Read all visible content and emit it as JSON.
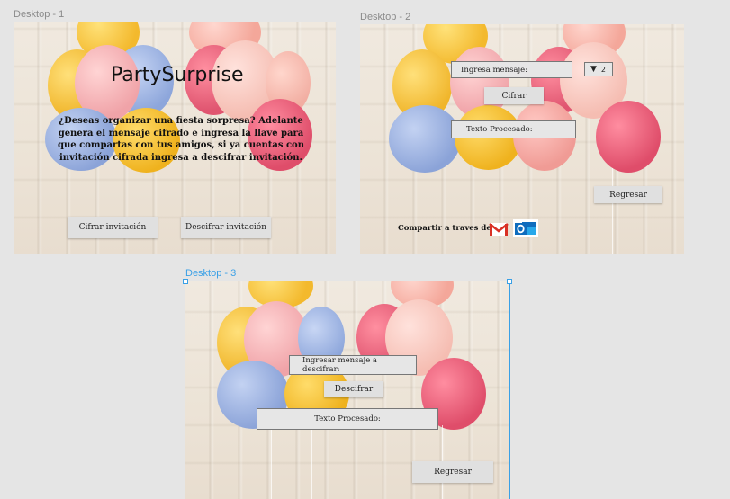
{
  "frames": {
    "desktop1": {
      "label": "Desktop - 1"
    },
    "desktop2": {
      "label": "Desktop - 2"
    },
    "desktop3": {
      "label": "Desktop - 3"
    }
  },
  "screen1": {
    "title": "PartySurprise",
    "description": "¿Deseas organizar una fiesta sorpresa? Adelante genera el mensaje cifrado e ingresa la llave para que compartas con tus amigos, si ya cuentas con invitación cifrada ingresa a descifrar invitación.",
    "encrypt_button": "Cifrar invitación",
    "decrypt_button": "Descifrar invitación"
  },
  "screen2": {
    "message_field": "Ingresa mensaje:",
    "key_select": {
      "arrow": "▼",
      "value": "2"
    },
    "encrypt_button": "Cifrar",
    "processed_field": "Texto Procesado:",
    "back_button": "Regresar",
    "share_label": "Compartir a traves de :",
    "share_icons": [
      "gmail-icon",
      "outlook-icon"
    ]
  },
  "screen3": {
    "message_field": "Ingresar mensaje a descifrar:",
    "decrypt_button": "Descifrar",
    "processed_field": "Texto Procesado:",
    "back_button": "Regresar"
  },
  "colors": {
    "canvas": "#e5e5e5",
    "selection": "#3aa0e6",
    "button": "#e0e0e0",
    "gmail_red": "#d93025",
    "outlook_blue": "#0f6cbd"
  }
}
